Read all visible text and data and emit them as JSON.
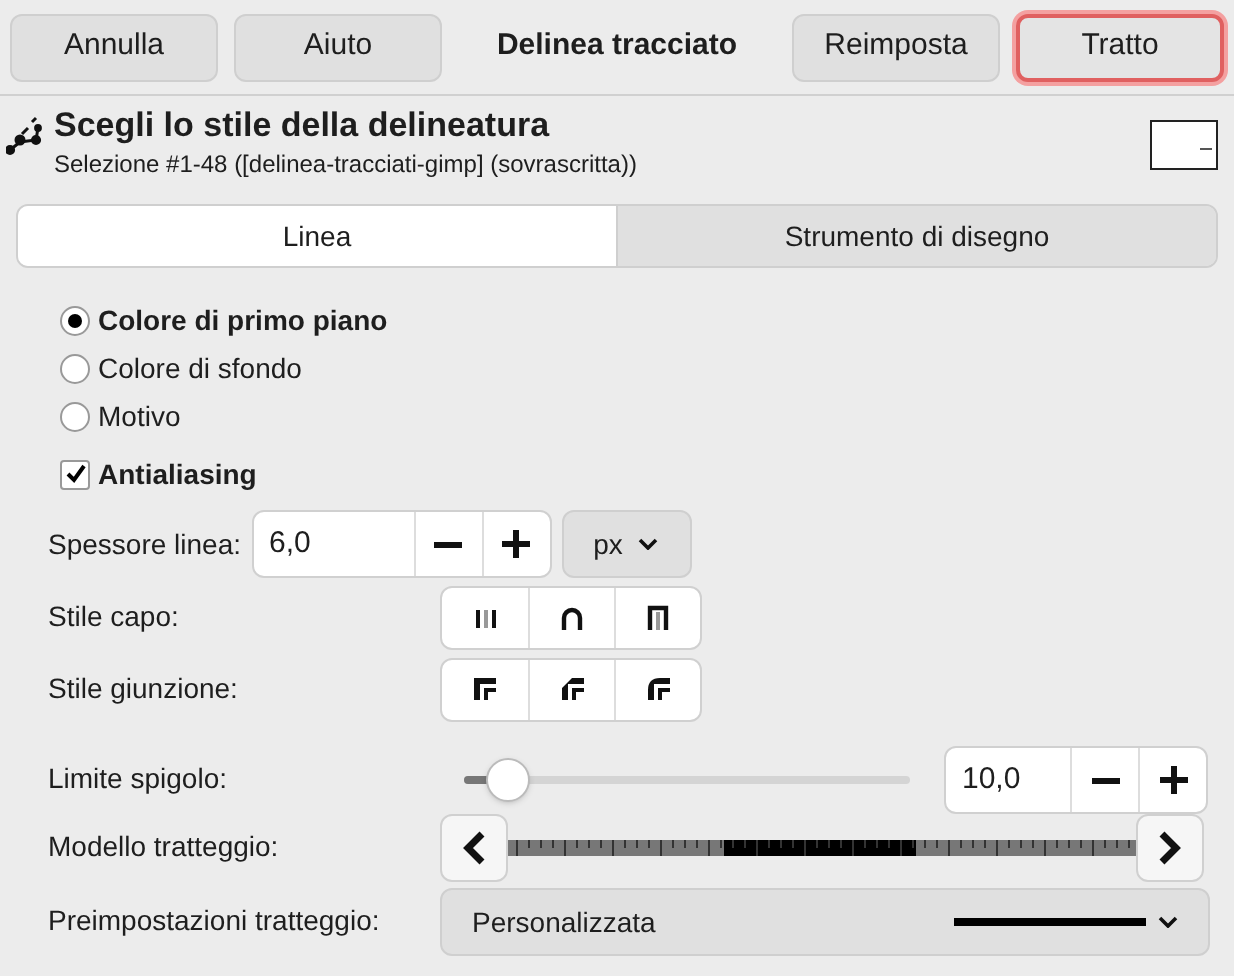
{
  "header": {
    "buttons": [
      {
        "label": "Annulla",
        "suggested": false
      },
      {
        "label": "Aiuto",
        "suggested": false
      }
    ],
    "title": "Delinea tracciato",
    "end_buttons": [
      {
        "label": "Reimposta",
        "suggested": false
      },
      {
        "label": "Tratto",
        "suggested": true
      }
    ]
  },
  "heading": {
    "title": "Scegli lo stile della delineatura",
    "subtitle": "Selezione #1-48 ([delinea-tracciati-gimp] (sovrascritta))"
  },
  "tabs": [
    {
      "label": "Linea",
      "selected": true
    },
    {
      "label": "Strumento di disegno",
      "selected": false
    }
  ],
  "fill_options": [
    {
      "label": "Colore di primo piano",
      "selected": true
    },
    {
      "label": "Colore di sfondo",
      "selected": false
    },
    {
      "label": "Motivo",
      "selected": false
    }
  ],
  "antialiasing": {
    "label": "Antialiasing",
    "checked": true
  },
  "line_width": {
    "label": "Spessore linea:",
    "value": "6,0",
    "unit": "px"
  },
  "cap_style": {
    "label": "Stile capo:"
  },
  "join_style": {
    "label": "Stile giunzione:"
  },
  "miter_limit": {
    "label": "Limite spigolo:",
    "level": 0.1,
    "value": "10,0"
  },
  "dash_pattern": {
    "label": "Modello tratteggio:"
  },
  "dash_preset": {
    "label": "Preimpostazioni tratteggio:",
    "value": "Personalizzata"
  }
}
